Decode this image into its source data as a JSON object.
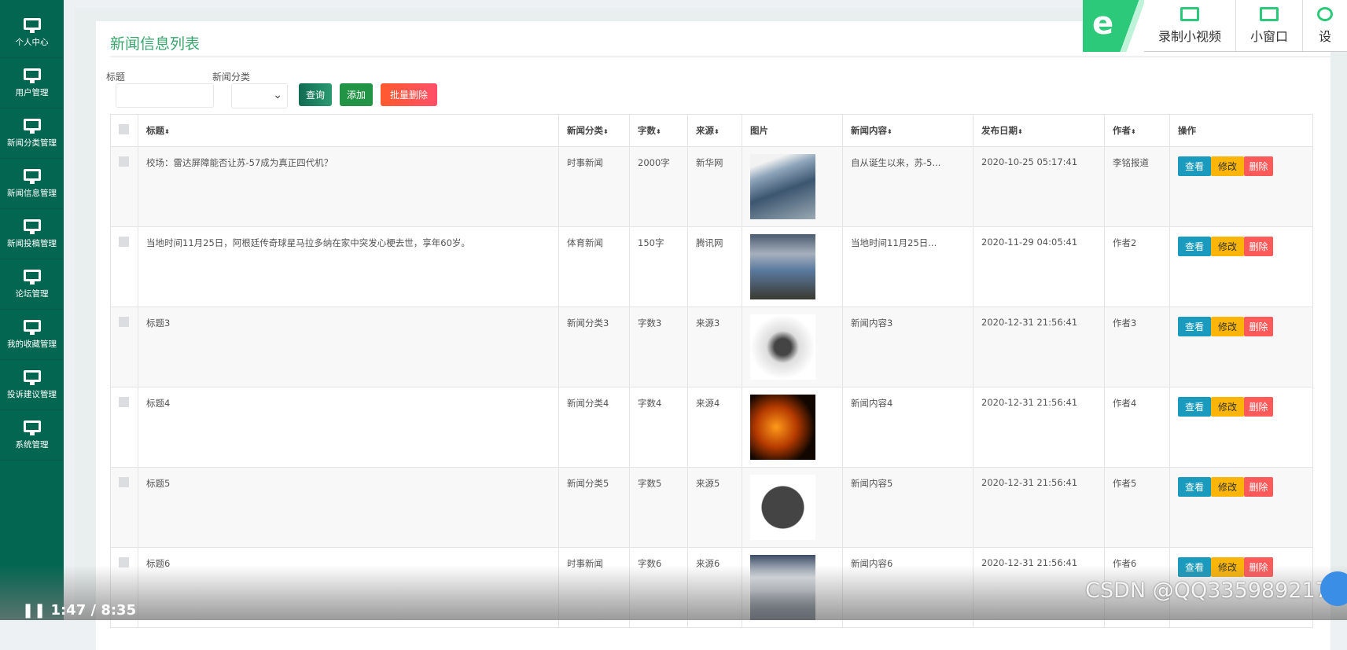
{
  "sidebar": {
    "items": [
      {
        "label": "个人中心"
      },
      {
        "label": "用户管理"
      },
      {
        "label": "新闻分类管理"
      },
      {
        "label": "新闻信息管理"
      },
      {
        "label": "新闻投稿管理"
      },
      {
        "label": "论坛管理"
      },
      {
        "label": "我的收藏管理"
      },
      {
        "label": "投诉建议管理"
      },
      {
        "label": "系统管理"
      }
    ]
  },
  "page": {
    "title": "新闻信息列表"
  },
  "search": {
    "title_label": "标题",
    "title_value": "",
    "category_label": "新闻分类",
    "category_value": "",
    "query": "查询",
    "add": "添加",
    "batch_delete": "批量删除"
  },
  "table": {
    "headers": [
      "标题",
      "新闻分类",
      "字数",
      "来源",
      "图片",
      "新闻内容",
      "发布日期",
      "作者",
      "操作"
    ],
    "rows": [
      {
        "title": "校场：雷达屏障能否让苏-57成为真正四代机？",
        "category": "时事新闻",
        "words": "2000字",
        "source": "新华网",
        "image": "fighter-jet",
        "content": "自从诞生以来，苏-5...",
        "date": "2020-10-25 05:17:41",
        "author": "李铭报道"
      },
      {
        "title": "当地时间11月25日，阿根廷传奇球星马拉多纳在家中突发心梗去世，享年60岁。",
        "category": "体育新闻",
        "words": "150字",
        "source": "腾讯网",
        "image": "stadium",
        "content": "当地时间11月25日...",
        "date": "2020-11-29 04:05:41",
        "author": "作者2"
      },
      {
        "title": "标题3",
        "category": "新闻分类3",
        "words": "字数3",
        "source": "来源3",
        "image": "newspaper",
        "content": "新闻内容3",
        "date": "2020-12-31 21:56:41",
        "author": "作者3"
      },
      {
        "title": "标题4",
        "category": "新闻分类4",
        "words": "字数4",
        "source": "来源4",
        "image": "money-fire",
        "content": "新闻内容4",
        "date": "2020-12-31 21:56:41",
        "author": "作者4"
      },
      {
        "title": "标题5",
        "category": "新闻分类5",
        "words": "字数5",
        "source": "来源5",
        "image": "news-globe",
        "content": "新闻内容5",
        "date": "2020-12-31 21:56:41",
        "author": "作者5"
      },
      {
        "title": "标题6",
        "category": "时事新闻",
        "words": "字数6",
        "source": "来源6",
        "image": "hospital-ship",
        "content": "新闻内容6",
        "date": "2020-12-31 21:56:41",
        "author": "作者6"
      }
    ],
    "actions": {
      "view": "查看",
      "edit": "修改",
      "delete": "删除"
    }
  },
  "toolbar": {
    "record": "录制小视频",
    "mini": "小窗口",
    "settings": "设"
  },
  "video": {
    "time": "1:47 / 8:35"
  },
  "watermark": "CSDN @QQ3359892174",
  "colors": {
    "sidebar": "#036651",
    "title": "#3aa66e",
    "query": "#1a8060",
    "add": "#239446",
    "batch_delete": "#ff5050",
    "view": "#1a9bbd",
    "edit": "#fbb508",
    "delete": "#ff5a5a"
  }
}
